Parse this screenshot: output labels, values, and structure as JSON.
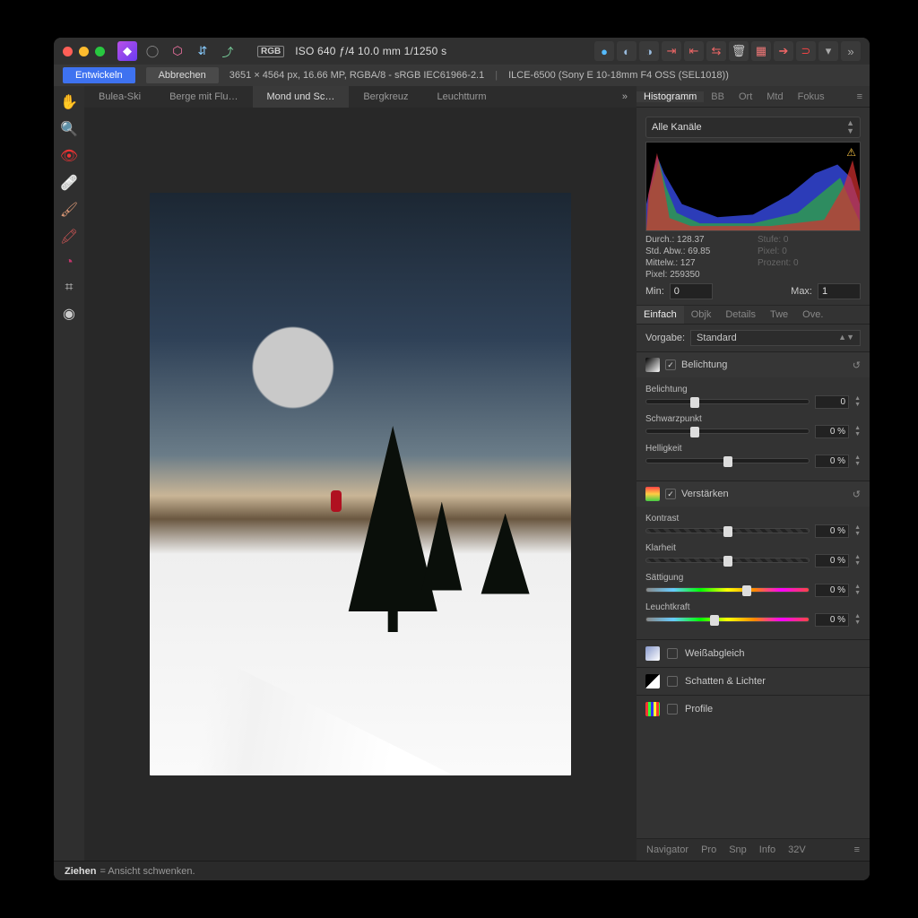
{
  "titlebar": {
    "rgb_badge": "RGB",
    "info": "ISO 640 ƒ/4 10.0 mm 1/1250 s"
  },
  "infobar": {
    "develop": "Entwickeln",
    "cancel": "Abbrechen",
    "dims": "3651 × 4564 px, 16.66 MP, RGBA/8 - sRGB IEC61966-2.1",
    "camera": "ILCE-6500 (Sony E 10-18mm F4 OSS (SEL1018))"
  },
  "doctabs": [
    "Bulea-Ski",
    "Berge mit Flu…",
    "Mond und Sc…",
    "Bergkreuz",
    "Leuchtturm"
  ],
  "doctab_active": 2,
  "panel_tabs": [
    "Histogramm",
    "BB",
    "Ort",
    "Mtd",
    "Fokus"
  ],
  "panel_tab_active": 0,
  "channel_select": "Alle Kanäle",
  "stats": {
    "durch": "Durch.: 128.37",
    "stdabw": "Std. Abw.: 69.85",
    "mittelw": "Mittelw.: 127",
    "pixel": "Pixel: 259350",
    "stufe": "Stufe: 0",
    "pixel0": "Pixel: 0",
    "prozent": "Prozent: 0"
  },
  "minmax": {
    "min_label": "Min:",
    "min": "0",
    "max_label": "Max:",
    "max": "1"
  },
  "subtabs": [
    "Einfach",
    "Objk",
    "Details",
    "Twe",
    "Ove."
  ],
  "subtab_active": 0,
  "preset": {
    "label": "Vorgabe:",
    "value": "Standard"
  },
  "exposure": {
    "title": "Belichtung",
    "sliders": [
      {
        "label": "Belichtung",
        "value": "0",
        "pos": 30
      },
      {
        "label": "Schwarzpunkt",
        "value": "0 %",
        "pos": 30
      },
      {
        "label": "Helligkeit",
        "value": "0 %",
        "pos": 50
      }
    ]
  },
  "enhance": {
    "title": "Verstärken",
    "sliders": [
      {
        "label": "Kontrast",
        "value": "0 %",
        "pos": 50,
        "style": "chk"
      },
      {
        "label": "Klarheit",
        "value": "0 %",
        "pos": 50,
        "style": "chk"
      },
      {
        "label": "Sättigung",
        "value": "0 %",
        "pos": 62,
        "style": "hue"
      },
      {
        "label": "Leuchtkraft",
        "value": "0 %",
        "pos": 42,
        "style": "hue"
      }
    ]
  },
  "collapsed": [
    {
      "label": "Weißabgleich",
      "swatch": "sw-grad"
    },
    {
      "label": "Schatten & Lichter",
      "swatch": "sw-split"
    },
    {
      "label": "Profile",
      "swatch": "sw-bars"
    }
  ],
  "bottom_tabs": [
    "Navigator",
    "Pro",
    "Snp",
    "Info",
    "32V"
  ],
  "status": {
    "bold": "Ziehen",
    "rest": " = Ansicht schwenken."
  }
}
